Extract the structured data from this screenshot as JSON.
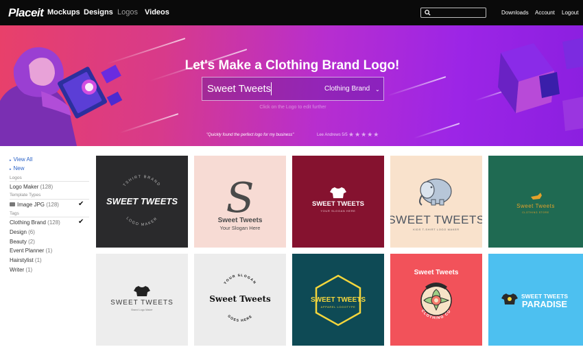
{
  "nav": {
    "logo": "Placeit",
    "links": [
      "Mockups",
      "Designs",
      "Logos",
      "Videos"
    ],
    "active_link": "Logos",
    "search_placeholder": "",
    "right_links": [
      "Downloads",
      "Account",
      "Logout"
    ]
  },
  "hero": {
    "title": "Let's Make a Clothing Brand Logo!",
    "input_value": "Sweet Tweets",
    "select_value": "Clothing Brand",
    "hint": "Click on the Logo to edit further",
    "quote": "\"Quickly found the perfect logo for my business\"",
    "quote_author": "Lee Andrews 5/5",
    "stars": "★★★★★"
  },
  "sidebar": {
    "view_all": "View All",
    "new": "New",
    "sections": {
      "logos": "Logos",
      "template_types": "Template Types",
      "tags": "Tags"
    },
    "logo_maker": {
      "label": "Logo Maker",
      "count": "(128)"
    },
    "image_jpg": {
      "label": "Image JPG",
      "count": "(128)"
    },
    "tags": [
      {
        "label": "Clothing Brand",
        "count": "(128)"
      },
      {
        "label": "Design",
        "count": "(6)"
      },
      {
        "label": "Beauty",
        "count": "(2)"
      },
      {
        "label": "Event Planner",
        "count": "(1)"
      },
      {
        "label": "Hairstylist",
        "count": "(1)"
      },
      {
        "label": "Writer",
        "count": "(1)"
      }
    ]
  },
  "tiles": [
    {
      "name": "SWEET TWEETS",
      "top": "TSHIRT BRAND",
      "bottom": "LOGO MAKER",
      "bg": "#2a2a2c",
      "fg": "#ffffff"
    },
    {
      "name": "Sweet Tweets",
      "letter": "S",
      "sub": "Your Slogan Here",
      "bg": "#f7dbd4",
      "fg": "#4a4a4a"
    },
    {
      "name": "SWEET TWEETS",
      "sub": "YOUR SLOGAN HERE",
      "bg": "#85122f",
      "fg": "#ffffff"
    },
    {
      "name": "SWEET TWEETS",
      "sub": "KIDS T-SHIRT LOGO MAKER",
      "bg": "#f9e2cc",
      "fg": "#4d5560"
    },
    {
      "name": "Sweet Tweets",
      "sub": "CLOTHING STORE",
      "bg": "#1f6a52",
      "fg": "#e3a12b"
    },
    {
      "name": "SWEET TWEETS",
      "sub": "Brand Logo Maker",
      "bg": "#ededed",
      "fg": "#3a3a3a"
    },
    {
      "name": "Sweet Tweets",
      "top": "YOUR SLOGAN",
      "bottom": "GOES HERE",
      "bg": "#ececec",
      "fg": "#111111"
    },
    {
      "name": "SWEET TWEETS",
      "sub": "APPAREL LOGOTYPE",
      "bg": "#0e4a55",
      "fg": "#f4d63c"
    },
    {
      "name": "Sweet Tweets",
      "bottom": "CLOTHING CO",
      "bg": "#f2525a",
      "fg": "#ffffff"
    },
    {
      "name": "SWEET TWEETS",
      "sub": "PARADISE",
      "bg": "#4dc0f0",
      "fg": "#ffffff"
    }
  ]
}
